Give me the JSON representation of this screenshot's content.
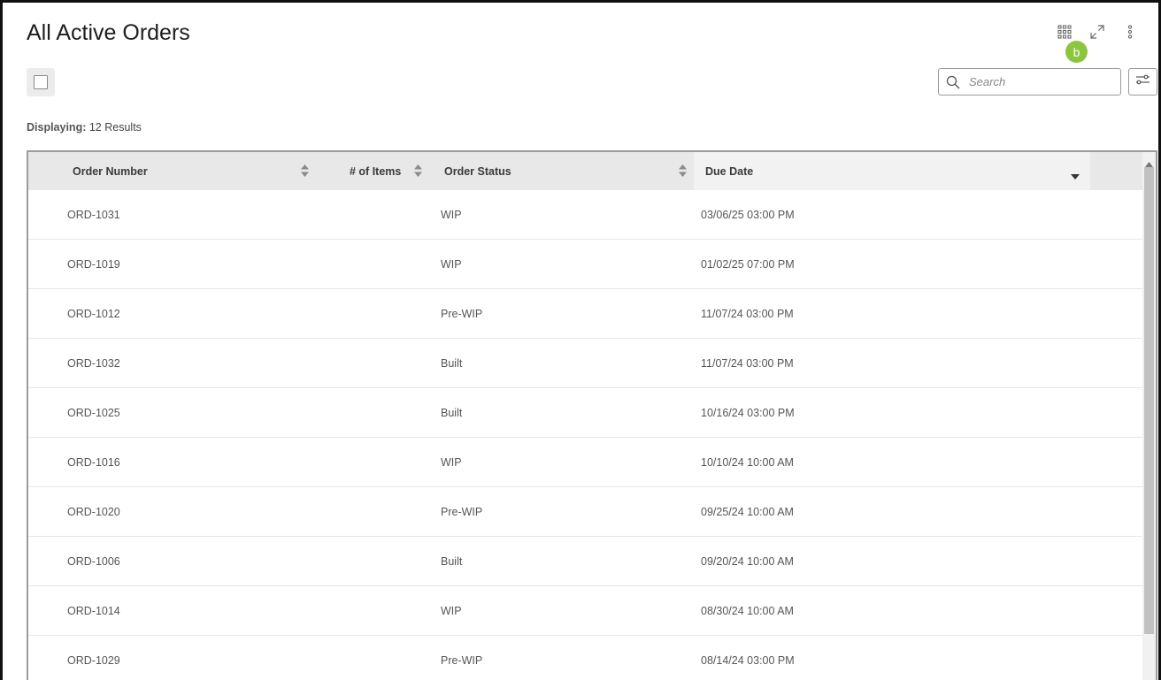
{
  "page": {
    "title": "All Active Orders",
    "user_badge": "b"
  },
  "toolbar": {
    "search_placeholder": "Search"
  },
  "results": {
    "label": "Displaying:",
    "count_text": "12 Results"
  },
  "table": {
    "columns": [
      {
        "label": "Order Number",
        "sort": "none"
      },
      {
        "label": "# of Items",
        "sort": "none"
      },
      {
        "label": "Order Status",
        "sort": "none"
      },
      {
        "label": "Due Date",
        "sort": "descending"
      }
    ],
    "rows": [
      {
        "order": "ORD-1031",
        "items": "",
        "status": "WIP",
        "due": "03/06/25 03:00 PM"
      },
      {
        "order": "ORD-1019",
        "items": "",
        "status": "WIP",
        "due": "01/02/25 07:00 PM"
      },
      {
        "order": "ORD-1012",
        "items": "",
        "status": "Pre-WIP",
        "due": "11/07/24 03:00 PM"
      },
      {
        "order": "ORD-1032",
        "items": "",
        "status": "Built",
        "due": "11/07/24 03:00 PM"
      },
      {
        "order": "ORD-1025",
        "items": "",
        "status": "Built",
        "due": "10/16/24 03:00 PM"
      },
      {
        "order": "ORD-1016",
        "items": "",
        "status": "WIP",
        "due": "10/10/24 10:00 AM"
      },
      {
        "order": "ORD-1020",
        "items": "",
        "status": "Pre-WIP",
        "due": "09/25/24 10:00 AM"
      },
      {
        "order": "ORD-1006",
        "items": "",
        "status": "Built",
        "due": "09/20/24 10:00 AM"
      },
      {
        "order": "ORD-1014",
        "items": "",
        "status": "WIP",
        "due": "08/30/24 10:00 AM"
      },
      {
        "order": "ORD-1029",
        "items": "",
        "status": "Pre-WIP",
        "due": "08/14/24 03:00 PM"
      }
    ]
  },
  "icons": {
    "apps": "grid-apps-icon",
    "expand": "expand-icon",
    "more": "more-vertical-icon",
    "search": "search-icon",
    "filter": "filter-sliders-icon"
  },
  "colors": {
    "badge": "#8cc63f",
    "header_bg": "#e8e8e8",
    "active_header_bg": "#f2f2f2"
  }
}
